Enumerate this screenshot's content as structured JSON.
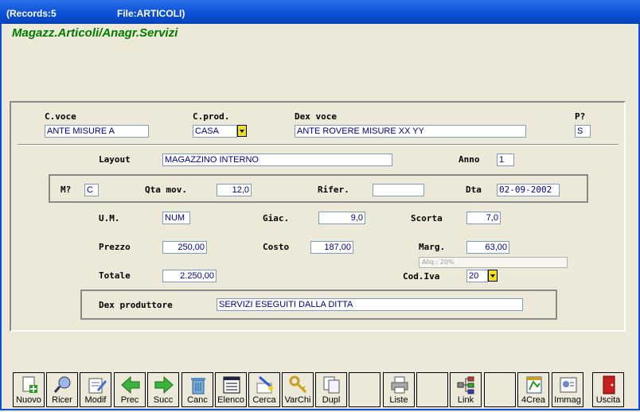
{
  "window": {
    "records": "(Records:5",
    "file": "File:ARTICOLI)"
  },
  "app_title": "Magazz.Articoli/Anagr.Servizi",
  "header": {
    "c_voce_label": "C.voce",
    "c_voce_value": "ANTE MISURE A",
    "c_prod_label": "C.prod.",
    "c_prod_value": "CASA",
    "dex_voce_label": "Dex voce",
    "dex_voce_value": "ANTE ROVERE MISURE XX YY",
    "p_label": "P?",
    "p_value": "S"
  },
  "details": {
    "layout_label": "Layout",
    "layout_value": "MAGAZZINO INTERNO",
    "anno_label": "Anno",
    "anno_value": "1",
    "m_label": "M?",
    "m_value": "C",
    "qta_label": "Qta mov.",
    "qta_value": "12,0",
    "rifer_label": "Rifer.",
    "rifer_value": "",
    "dta_label": "Dta",
    "dta_value": "02-09-2002",
    "um_label": "U.M.",
    "um_value": "NUM",
    "giac_label": "Giac.",
    "giac_value": "9,0",
    "scorta_label": "Scorta",
    "scorta_value": "7,0",
    "prezzo_label": "Prezzo",
    "prezzo_value": "250,00",
    "costo_label": "Costo",
    "costo_value": "187,00",
    "marg_label": "Marg.",
    "marg_value": "63,00",
    "aliq_hint": "Aliq.: 20%",
    "totale_label": "Totale",
    "totale_value": "2.250,00",
    "codiva_label": "Cod.Iva",
    "codiva_value": "20",
    "dex_prod_label": "Dex produttore",
    "dex_prod_value": "SERVIZI ESEGUITI DALLA DITTA"
  },
  "toolbar": [
    {
      "label": "Nuovo",
      "icon": "new-document-icon"
    },
    {
      "label": "Ricer",
      "icon": "search-icon"
    },
    {
      "label": "Modif",
      "icon": "edit-icon"
    },
    {
      "label": "Prec",
      "icon": "arrow-left-icon"
    },
    {
      "label": "Succ",
      "icon": "arrow-right-icon"
    },
    {
      "label": "Canc",
      "icon": "trash-icon"
    },
    {
      "label": "Elenco",
      "icon": "list-icon"
    },
    {
      "label": "Cerca",
      "icon": "find-icon"
    },
    {
      "label": "VarChi",
      "icon": "keys-icon"
    },
    {
      "label": "Dupl",
      "icon": "duplicate-icon"
    },
    {
      "label": "",
      "icon": ""
    },
    {
      "label": "Liste",
      "icon": "printer-icon"
    },
    {
      "label": "",
      "icon": ""
    },
    {
      "label": "Link",
      "icon": "link-icon"
    },
    {
      "label": "",
      "icon": ""
    },
    {
      "label": "4Crea",
      "icon": "create-icon"
    },
    {
      "label": "Immag",
      "icon": "image-icon"
    },
    {
      "label": "",
      "icon": ""
    },
    {
      "label": "Uscita",
      "icon": "exit-door-icon"
    }
  ],
  "colors": {
    "title_green": "#007a00",
    "field_text": "#000080",
    "titlebar_blue": "#0a4fd6",
    "dropdown_yellow": "#f0e020"
  }
}
